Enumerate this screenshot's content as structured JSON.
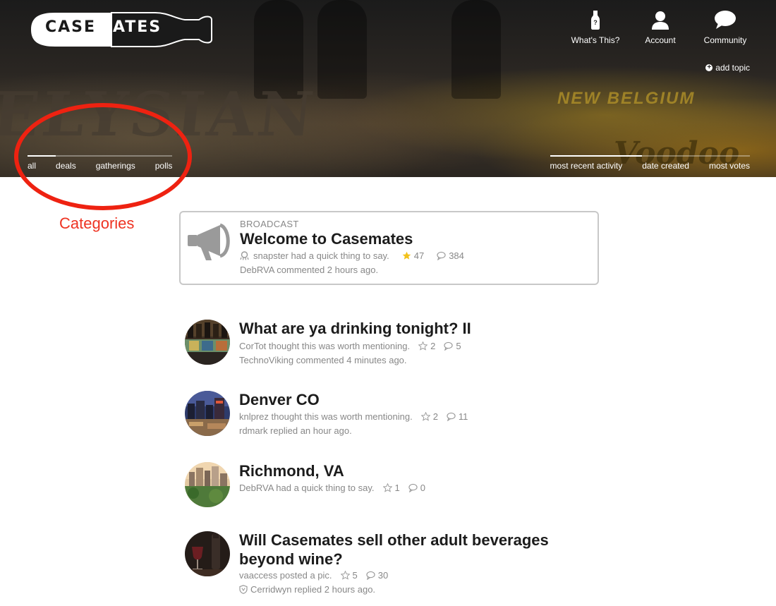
{
  "brand": {
    "logo_part1": "CASE",
    "logo_part2": "MATES"
  },
  "topnav": {
    "whats_this": "What's This?",
    "account": "Account",
    "community": "Community",
    "add_topic": "add topic"
  },
  "categories": {
    "all": "all",
    "deals": "deals",
    "gatherings": "gatherings",
    "polls": "polls"
  },
  "sort": {
    "recent": "most recent activity",
    "created": "date created",
    "votes": "most votes"
  },
  "annotation": {
    "label": "Categories"
  },
  "broadcast": {
    "kicker": "BROADCAST",
    "title": "Welcome to Casemates",
    "meta": "snapster had a quick thing to say.",
    "stars": "47",
    "comments": "384",
    "activity": "DebRVA commented 2 hours ago."
  },
  "topics": [
    {
      "title": "What are ya drinking tonight? II",
      "meta": "CorTot thought this was worth mentioning.",
      "stars": "2",
      "comments": "5",
      "activity": "TechnoViking commented 4 minutes ago."
    },
    {
      "title": "Denver CO",
      "meta": "knlprez thought this was worth mentioning.",
      "stars": "2",
      "comments": "11",
      "activity": "rdmark replied an hour ago."
    },
    {
      "title": "Richmond, VA",
      "meta": "DebRVA had a quick thing to say.",
      "stars": "1",
      "comments": "0",
      "activity": ""
    },
    {
      "title": "Will Casemates sell other adult beverages beyond wine?",
      "meta": "vaaccess posted a pic.",
      "stars": "5",
      "comments": "30",
      "activity": "Cerridwyn replied 2 hours ago."
    }
  ],
  "colors": {
    "annotation": "#ee2211",
    "star_active": "#f2c21b",
    "muted_text": "#888888"
  }
}
